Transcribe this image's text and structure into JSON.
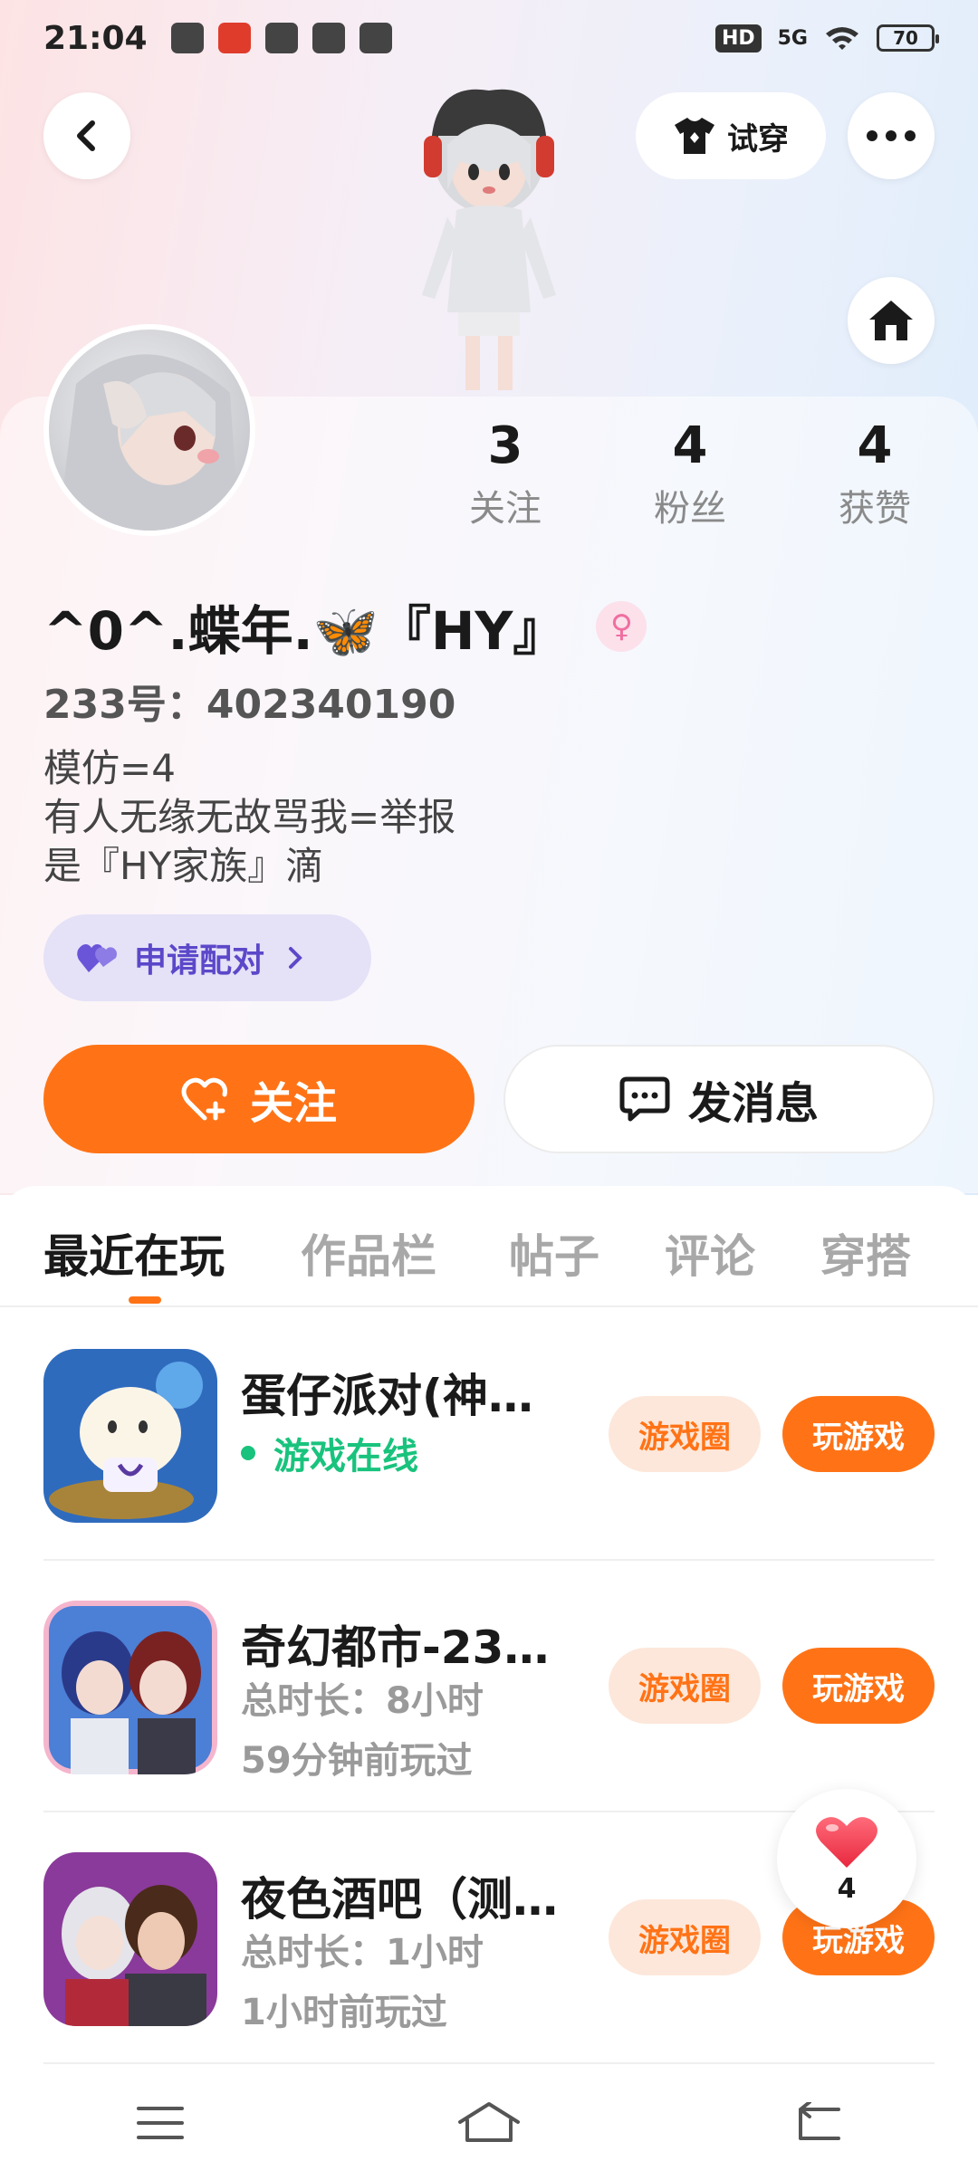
{
  "status_bar": {
    "time": "21:04",
    "hd": "HD",
    "network": "5G",
    "battery": "70"
  },
  "header": {
    "try_on_label": "试穿"
  },
  "profile": {
    "stats": [
      {
        "value": "3",
        "label": "关注"
      },
      {
        "value": "4",
        "label": "粉丝"
      },
      {
        "value": "4",
        "label": "获赞"
      }
    ],
    "nickname": "^0^.蝶年.🦋『HY』",
    "gender_symbol": "♀",
    "uid": "233号：402340190",
    "bio_lines": [
      "模仿=4",
      "有人无缘无故骂我=举报",
      "是『HY家族』滴"
    ],
    "pair_label": "申请配对"
  },
  "actions": {
    "follow_label": "关注",
    "message_label": "发消息"
  },
  "tabs": [
    "最近在玩",
    "作品栏",
    "帖子",
    "评论",
    "穿搭"
  ],
  "games": [
    {
      "title": "蛋仔派对(神…",
      "line1": "游戏在线",
      "line2": "",
      "circle_label": "游戏圈",
      "play_label": "玩游戏"
    },
    {
      "title": "奇幻都市-23…",
      "line1": "总时长：8小时",
      "line2": "59分钟前玩过",
      "circle_label": "游戏圈",
      "play_label": "玩游戏"
    },
    {
      "title": "夜色酒吧（测…",
      "line1": "总时长：1小时",
      "line2": "1小时前玩过",
      "circle_label": "游戏圈",
      "play_label": "玩游戏"
    }
  ],
  "like_float": {
    "count": "4"
  },
  "colors": {
    "accent": "#ff7316",
    "online": "#19c37d",
    "pair": "#5b48c9"
  }
}
